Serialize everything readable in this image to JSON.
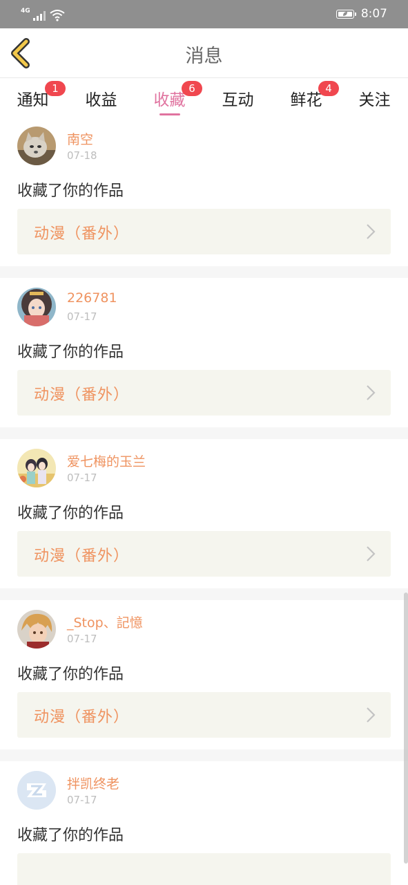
{
  "status_bar": {
    "network": "4G",
    "time": "8:07",
    "icons": [
      "signal-icon",
      "wifi-icon",
      "battery-icon"
    ]
  },
  "header": {
    "title": "消息",
    "back_icon": "chevron-left-icon"
  },
  "tabs": [
    {
      "label": "通知",
      "badge": "1"
    },
    {
      "label": "收益",
      "badge": ""
    },
    {
      "label": "收藏",
      "badge": "6",
      "active": true
    },
    {
      "label": "互动",
      "badge": ""
    },
    {
      "label": "鲜花",
      "badge": "4"
    },
    {
      "label": "关注",
      "badge": ""
    }
  ],
  "items": [
    {
      "name": "南空",
      "date": "07-18",
      "action": "收藏了你的作品",
      "work": "动漫（番外）"
    },
    {
      "name": "226781",
      "date": "07-17",
      "action": "收藏了你的作品",
      "work": "动漫（番外）"
    },
    {
      "name": "爱七梅的玉兰",
      "date": "07-17",
      "action": "收藏了你的作品",
      "work": "动漫（番外）"
    },
    {
      "name": "_Stop、記憶",
      "date": "07-17",
      "action": "收藏了你的作品",
      "work": "动漫（番外）"
    },
    {
      "name": "拌凯终老",
      "date": "07-17",
      "action": "收藏了你的作品",
      "work": ""
    }
  ],
  "colors": {
    "accent": "#e0739f",
    "username": "#ef9360",
    "badge": "#f0474f",
    "card_bg": "#f5f5ee",
    "back_icon": "#f2c84b"
  }
}
